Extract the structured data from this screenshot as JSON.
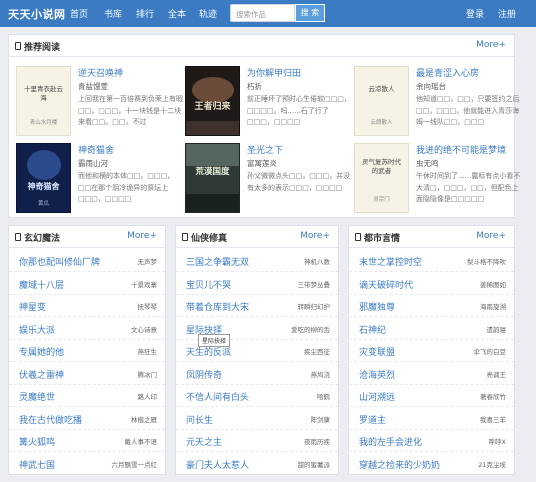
{
  "header": {
    "logo": "天天小说网",
    "nav": [
      "首页",
      "书库",
      "排行",
      "全本",
      "轨迹"
    ],
    "search_placeholder": "搜索作品",
    "search_button": "搜 索",
    "login": "登录",
    "register": "注册"
  },
  "recommend": {
    "title": "推荐阅读",
    "more": "More+",
    "books": [
      {
        "title": "逆天召唤神",
        "author": "青盐馒萱",
        "desc": "上回我在第一百倍赛到负荣上有暇□□，□□□，十一块钱是十二块来看□□。□□，不过",
        "cover_text": "十里青衣赴云海",
        "cover_sub": "青山水月楼"
      },
      {
        "title": "为你解甲归田",
        "author": "朽折",
        "desc": "前正睡坏了预时心生倦软□□□，□□□□。吗......石了行了□□□，□□□□",
        "cover_text": "王者归来",
        "cover_sub": ""
      },
      {
        "title": "最是青涩入心房",
        "author": "余向瑶台",
        "desc": "他知道□□，□□，只要签约之后□□，□□□，他就能进入青莎海姆一线队□□，□□□",
        "cover_text": "云凉散人",
        "cover_sub": "云朗散人"
      },
      {
        "title": "神奇猫舍",
        "author": "霸雨山河",
        "desc": "而他和横的本体□□，□□□，□□在那个阴冷诡异的祭坛上□□□，□□□□",
        "cover_text": "神奇猫舍",
        "cover_sub": "黄瓜"
      },
      {
        "title": "圣光之下",
        "author": "富寓莲炎",
        "desc": "孙父微微点头□□，□□□，并没有太多的表示□□□，□□□□",
        "cover_text": "荒漠国度",
        "cover_sub": ""
      },
      {
        "title": "我进的绝不可能是梦境",
        "author": "虫无鸣",
        "desc": "午休时间到了......露标有点小看不大清□，□□□，□□，但配色上面隐隐像是□□□□□",
        "cover_text": "灵气复苏时代的武者",
        "cover_sub": "灵宗门"
      }
    ]
  },
  "categories": [
    {
      "title": "玄幻魔法",
      "more": "More+",
      "items": [
        {
          "title": "你那也配叫修仙厂牌",
          "author": "无声梦"
        },
        {
          "title": "魔域十八层",
          "author": "十景戏寨"
        },
        {
          "title": "神星变",
          "author": "抚琴琴"
        },
        {
          "title": "娱乐大派",
          "author": "文心诗意"
        },
        {
          "title": "专属她的他",
          "author": "燕狂生"
        },
        {
          "title": "伏羲之雷神",
          "author": "腾冰门"
        },
        {
          "title": "灵魔绝世",
          "author": "路人印"
        },
        {
          "title": "我在古代做吃播",
          "author": "林楷之雁"
        },
        {
          "title": "篝火狐鸣",
          "author": "戴人事不语"
        },
        {
          "title": "神武七国",
          "author": "六月飘雪一点红"
        }
      ]
    },
    {
      "title": "仙侠修真",
      "more": "More+",
      "items": [
        {
          "title": "三国之争霸无双",
          "author": "神机八数"
        },
        {
          "title": "宝贝儿不哭",
          "author": "三带梦丛叠"
        },
        {
          "title": "带着仓库到大宋",
          "author": "转瞬归幻护"
        },
        {
          "title": "星际抉择",
          "author": "爱吃的柳的舌"
        },
        {
          "title": "天生的反派",
          "author": "疾尘西征"
        },
        {
          "title": "凤阴传奇",
          "author": "燕鸠浇"
        },
        {
          "title": "不信人间有白头",
          "author": "哈鹤"
        },
        {
          "title": "问长生",
          "author": "陈剑康"
        },
        {
          "title": "元天之主",
          "author": "夜雨历疾"
        },
        {
          "title": "豪门夫人太惹人",
          "author": "甜的蜜薯派"
        }
      ]
    },
    {
      "title": "都市言情",
      "more": "More+",
      "items": [
        {
          "title": "末世之掌控时空",
          "author": "梨斗格不降吹"
        },
        {
          "title": "谪天破碎时代",
          "author": "姜稀图如"
        },
        {
          "title": "邪魔独尊",
          "author": "海南旋溯"
        },
        {
          "title": "石神纪",
          "author": "遗韵寝"
        },
        {
          "title": "灾变联盟",
          "author": "伞飞的白豆"
        },
        {
          "title": "沧海英烈",
          "author": "亮调王"
        },
        {
          "title": "山河溯远",
          "author": "著春欣竹"
        },
        {
          "title": "罗道主",
          "author": "我喜三羊"
        },
        {
          "title": "我的左手会进化",
          "author": "呼呼X"
        },
        {
          "title": "穿越之捡来的少奶奶",
          "author": "21克尘埃"
        }
      ]
    }
  ],
  "tooltip": "星际抉择",
  "colors": {
    "header": "#3a7bc4",
    "link": "#3a7bc4",
    "background": "#eaedf1"
  }
}
